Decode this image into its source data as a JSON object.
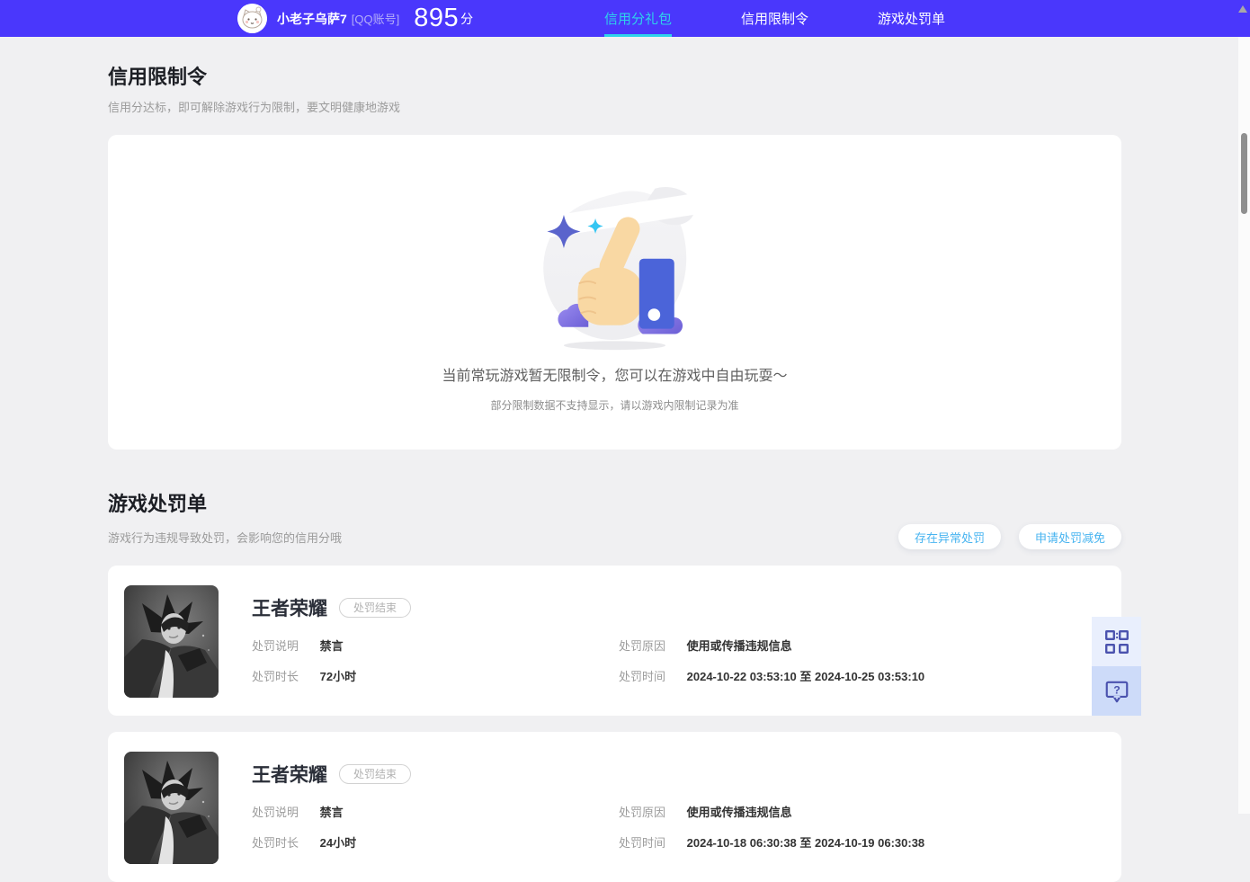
{
  "theme": {
    "header_bg": "#4a37fc",
    "accent_cyan": "#2ed3ea",
    "page_bg": "#f0f0f2",
    "action_blue": "#48b4f0",
    "widget_icon_color": "#4a52ae"
  },
  "header": {
    "avatar_icon": "cat-avatar",
    "username": "小老子乌萨7",
    "account_type": "[QQ账号]",
    "score": "895",
    "score_unit": "分",
    "tabs": [
      {
        "label": "信用分礼包",
        "active": true
      },
      {
        "label": "信用限制令",
        "active": false
      },
      {
        "label": "游戏处罚单",
        "active": false
      }
    ]
  },
  "restriction_section": {
    "title": "信用限制令",
    "subtitle": "信用分达标，即可解除游戏行为限制，要文明健康地游戏",
    "illustration": "thumbs-up-illustration",
    "empty_message": "当前常玩游戏暂无限制令，您可以在游戏中自由玩耍～",
    "empty_note": "部分限制数据不支持显示，请以游戏内限制记录为准"
  },
  "penalty_section": {
    "title": "游戏处罚单",
    "subtitle": "游戏行为违规导致处罚，会影响您的信用分哦",
    "actions": [
      {
        "label": "存在异常处罚"
      },
      {
        "label": "申请处罚减免"
      }
    ],
    "labels": {
      "desc": "处罚说明",
      "duration": "处罚时长",
      "reason": "处罚原因",
      "time": "处罚时间"
    },
    "cards": [
      {
        "game": "王者荣耀",
        "status": "处罚结束",
        "thumb_icon": "honor-of-kings-grayscale-art",
        "desc": "禁言",
        "duration": "72小时",
        "reason": "使用或传播违规信息",
        "time": "2024-10-22 03:53:10 至 2024-10-25 03:53:10"
      },
      {
        "game": "王者荣耀",
        "status": "处罚结束",
        "thumb_icon": "honor-of-kings-grayscale-art",
        "desc": "禁言",
        "duration": "24小时",
        "reason": "使用或传播违规信息",
        "time": "2024-10-18 06:30:38 至 2024-10-19 06:30:38"
      }
    ]
  },
  "floating_widget": {
    "qr_icon": "qr-code-icon",
    "help_icon": "question-bubble-icon",
    "help_glyph": "?"
  }
}
